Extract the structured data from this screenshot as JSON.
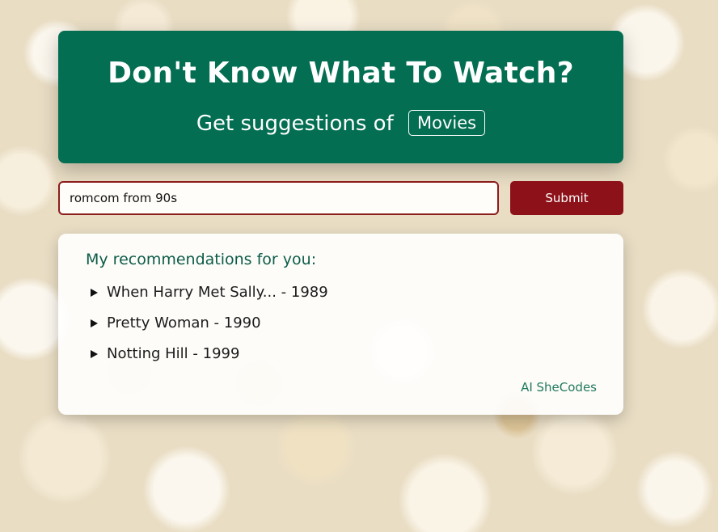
{
  "header": {
    "title": "Don't Know What To Watch?",
    "subtitle": "Get suggestions of",
    "tag": "Movies",
    "background_color": "#036e52"
  },
  "search": {
    "value": "romcom from 90s",
    "placeholder": "",
    "submit_label": "Submit",
    "submit_color": "#8d1118"
  },
  "results": {
    "heading": "My recommendations for you:",
    "items": [
      {
        "label": "When Harry Met Sally... - 1989"
      },
      {
        "label": "Pretty Woman - 1990"
      },
      {
        "label": "Notting Hill - 1999"
      }
    ],
    "expand_icon": "triangle-right-icon"
  },
  "footer": {
    "credit": "AI SheCodes"
  },
  "background": {
    "image": "popcorn-background"
  }
}
